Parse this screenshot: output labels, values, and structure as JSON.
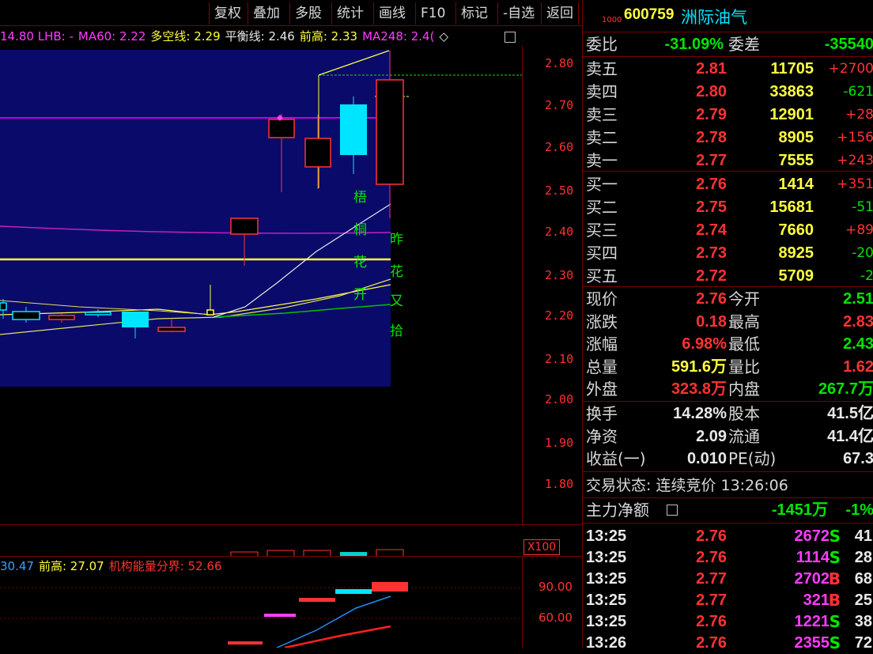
{
  "toolbar": {
    "buttons": [
      "复权",
      "叠加",
      "多股",
      "统计",
      "画线",
      "F10",
      "标记",
      "-自选",
      "返回"
    ]
  },
  "indicators": {
    "first": "14.80 LHB: -",
    "ma60": "MA60: 2.22",
    "duokong": "多空线: 2.29",
    "pingheng": "平衡线: 2.46",
    "qiangao": "前高: 2.33",
    "ma248": "MA248: 2.4(",
    "diamond": "◇"
  },
  "price_axis": [
    "2.80",
    "2.70",
    "2.60",
    "2.50",
    "2.40",
    "2.30",
    "2.20",
    "2.10",
    "2.00",
    "1.90",
    "1.80"
  ],
  "chart_annotations": {
    "col1": [
      "梧",
      "桐",
      "花",
      "开"
    ],
    "col2": [
      "昨",
      "花",
      "又",
      "拾"
    ]
  },
  "volume_strip": {
    "label": "X100"
  },
  "sub_indicator": {
    "val1": "30.47",
    "qiangao": "前高: 27.07",
    "jigou": "机构能量分界: 52.66",
    "axis": [
      "90.00",
      "60.00"
    ]
  },
  "stock": {
    "code_prefix": "1000",
    "code": "600759",
    "name": "洲际油气"
  },
  "weibi": {
    "label1": "委比",
    "val1": "-31.09%",
    "label2": "委差",
    "val2": "-35540"
  },
  "asks": [
    {
      "label": "卖五",
      "price": "2.81",
      "vol": "11705",
      "chg": "+2700"
    },
    {
      "label": "卖四",
      "price": "2.80",
      "vol": "33863",
      "chg": "-621"
    },
    {
      "label": "卖三",
      "price": "2.79",
      "vol": "12901",
      "chg": "+28"
    },
    {
      "label": "卖二",
      "price": "2.78",
      "vol": "8905",
      "chg": "+156"
    },
    {
      "label": "卖一",
      "price": "2.77",
      "vol": "7555",
      "chg": "+243"
    }
  ],
  "bids": [
    {
      "label": "买一",
      "price": "2.76",
      "vol": "1414",
      "chg": "+351"
    },
    {
      "label": "买二",
      "price": "2.75",
      "vol": "15681",
      "chg": "-51"
    },
    {
      "label": "买三",
      "price": "2.74",
      "vol": "7660",
      "chg": "+89"
    },
    {
      "label": "买四",
      "price": "2.73",
      "vol": "8925",
      "chg": "-20"
    },
    {
      "label": "买五",
      "price": "2.72",
      "vol": "5709",
      "chg": "-2"
    }
  ],
  "quote": [
    {
      "l1": "现价",
      "v1": "2.76",
      "l2": "今开",
      "v2": "2.51"
    },
    {
      "l1": "涨跌",
      "v1": "0.18",
      "l2": "最高",
      "v2": "2.83"
    },
    {
      "l1": "涨幅",
      "v1": "6.98%",
      "l2": "最低",
      "v2": "2.43"
    },
    {
      "l1": "总量",
      "v1": "591.6万",
      "l2": "量比",
      "v2": "1.62"
    },
    {
      "l1": "外盘",
      "v1": "323.8万",
      "l2": "内盘",
      "v2": "267.7万"
    }
  ],
  "fundamentals": [
    {
      "l1": "换手",
      "v1": "14.28%",
      "l2": "股本",
      "v2": "41.5亿"
    },
    {
      "l1": "净资",
      "v1": "2.09",
      "l2": "流通",
      "v2": "41.4亿"
    },
    {
      "l1": "收益(一)",
      "v1": "0.010",
      "l2": "PE(动)",
      "v2": "67.3"
    }
  ],
  "trade_status": "交易状态: 连续竞价 13:26:06",
  "capital": {
    "label": "主力净额",
    "val": "-1451万",
    "pct": "-1%"
  },
  "ticks": [
    {
      "time": "13:25",
      "price": "2.76",
      "vol": "2672",
      "dir": "S",
      "n": "41"
    },
    {
      "time": "13:25",
      "price": "2.76",
      "vol": "1114",
      "dir": "S",
      "n": "28"
    },
    {
      "time": "13:25",
      "price": "2.77",
      "vol": "2702",
      "dir": "B",
      "n": "68"
    },
    {
      "time": "13:25",
      "price": "2.77",
      "vol": "321",
      "dir": "B",
      "n": "25"
    },
    {
      "time": "13:25",
      "price": "2.76",
      "vol": "1221",
      "dir": "S",
      "n": "38"
    },
    {
      "time": "13:26",
      "price": "2.76",
      "vol": "2355",
      "dir": "S",
      "n": "72"
    }
  ],
  "colors": {
    "up": "#ff3232",
    "down": "#00e600",
    "bg": "#000000",
    "panel_border": "#7a0000"
  }
}
